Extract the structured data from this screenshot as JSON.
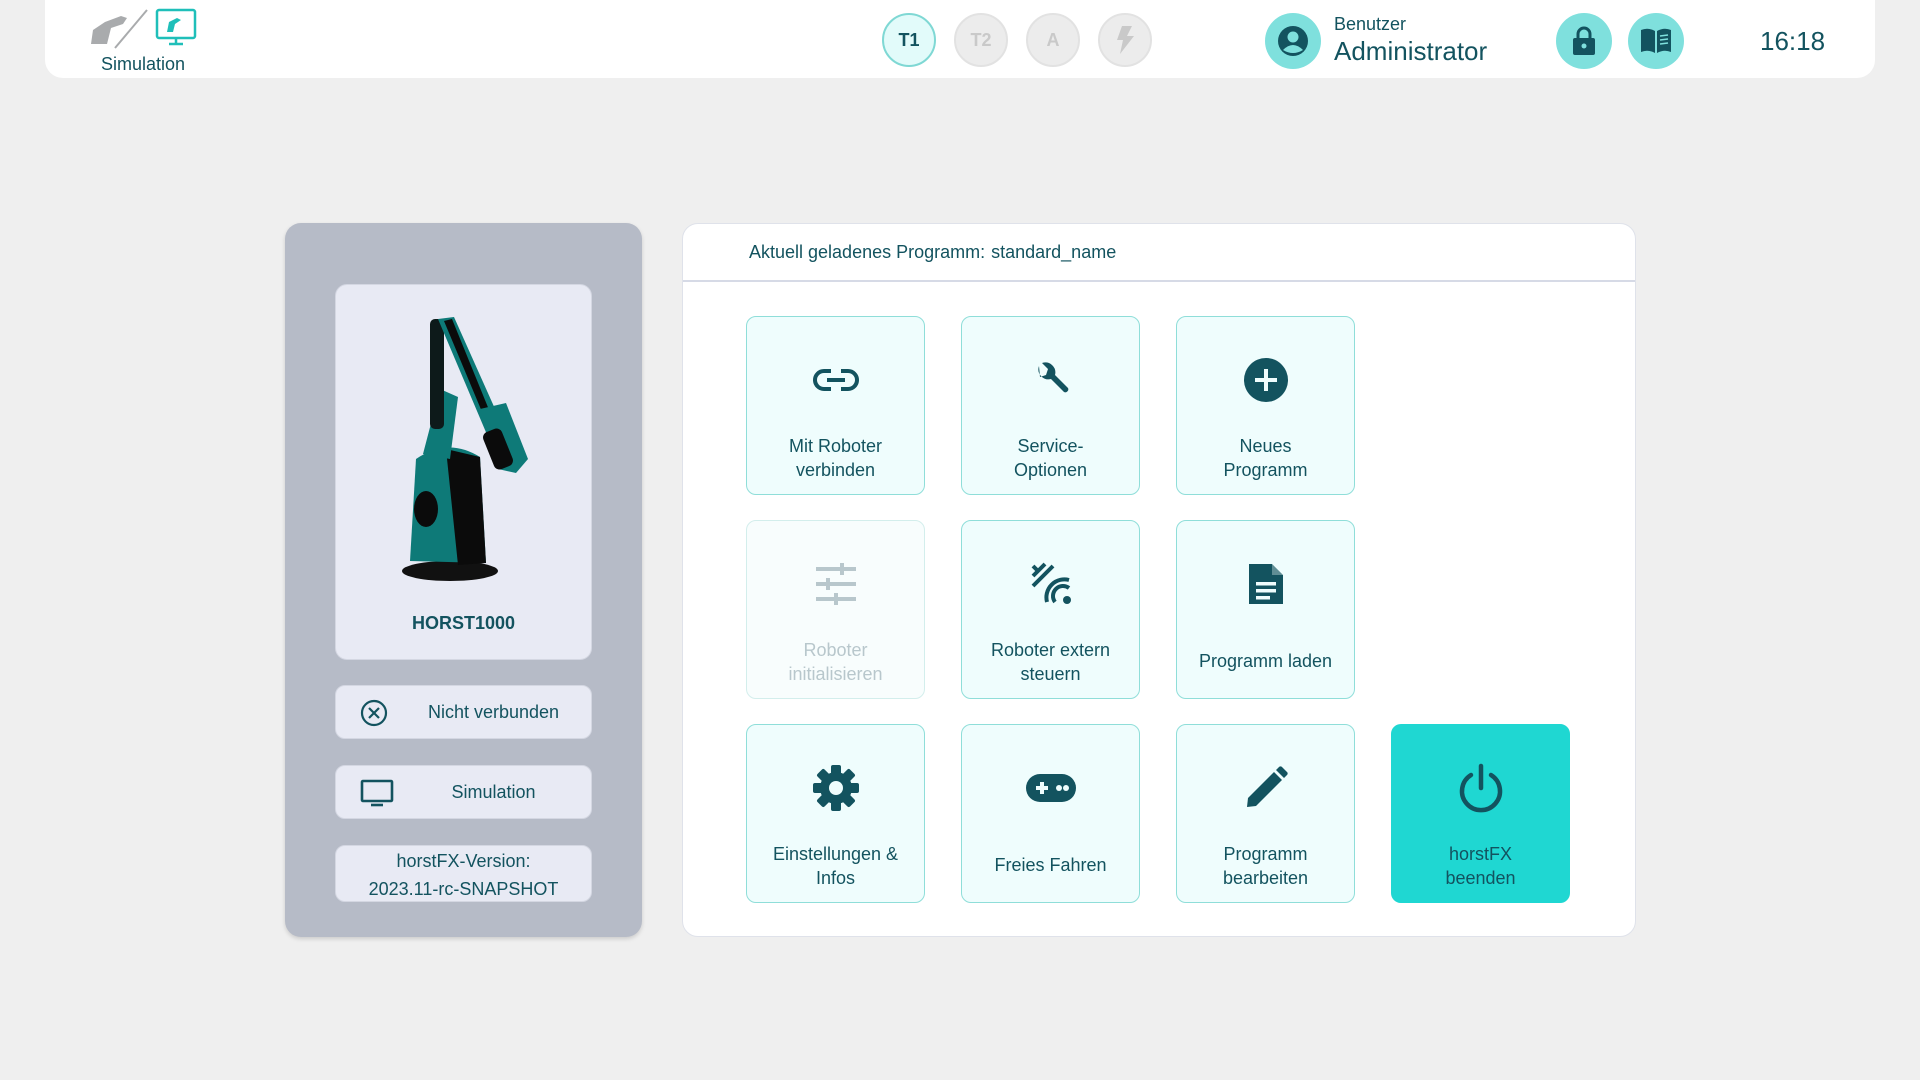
{
  "colors": {
    "primary_text": "#13535f",
    "accent": "#1fd7d2",
    "tile_bg": "#effdfd",
    "tile_border": "#8fded9",
    "side_panel": "#b6bbc7"
  },
  "topbar": {
    "mode_label": "Simulation",
    "mode_icons": [
      "robot-arm-icon",
      "monitor-robot-icon"
    ],
    "operating_modes": [
      {
        "label": "T1",
        "active": true
      },
      {
        "label": "T2",
        "active": false
      },
      {
        "label": "A",
        "active": false
      },
      {
        "icon": "lightning-icon",
        "active": false
      }
    ],
    "user": {
      "icon": "account-circle-icon",
      "label": "Benutzer",
      "name": "Administrator"
    },
    "lock_icon": "lock-icon",
    "manual_icon": "book-icon",
    "time": "16:18"
  },
  "sidebar": {
    "robot_name": "HORST1000",
    "connection_status": {
      "icon": "close-circle-icon",
      "label": "Nicht verbunden"
    },
    "simulation_button": {
      "icon": "monitor-icon",
      "label": "Simulation"
    },
    "version_label": "horstFX-Version:",
    "version_value": "2023.11-rc-SNAPSHOT"
  },
  "main": {
    "loaded_program_label": "Aktuell geladenes Programm:",
    "loaded_program_name": "standard_name",
    "tiles": [
      {
        "icon": "link-icon",
        "line1": "Mit Roboter",
        "line2": "verbinden",
        "enabled": true
      },
      {
        "icon": "wrench-icon",
        "line1": "Service-",
        "line2": "Optionen",
        "enabled": true
      },
      {
        "icon": "plus-circle-icon",
        "line1": "Neues",
        "line2": "Programm",
        "enabled": true
      },
      {
        "icon": "sliders-icon",
        "line1": "Roboter",
        "line2": "initialisieren",
        "enabled": false
      },
      {
        "icon": "remote-signal-icon",
        "line1": "Roboter extern",
        "line2": "steuern",
        "enabled": true
      },
      {
        "icon": "document-icon",
        "line1": "Programm laden",
        "line2": "",
        "enabled": true
      },
      {
        "icon": "gear-icon",
        "line1": "Einstellungen &",
        "line2": "Infos",
        "enabled": true
      },
      {
        "icon": "gamepad-icon",
        "line1": "Freies Fahren",
        "line2": "",
        "enabled": true
      },
      {
        "icon": "pencil-icon",
        "line1": "Programm",
        "line2": "bearbeiten",
        "enabled": true
      },
      {
        "icon": "power-icon",
        "line1": "horstFX",
        "line2": "beenden",
        "enabled": true
      }
    ]
  }
}
